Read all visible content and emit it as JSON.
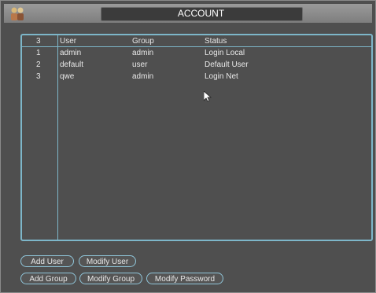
{
  "window": {
    "title": "ACCOUNT",
    "icon": "users-icon"
  },
  "table": {
    "headers": [
      "3",
      "User",
      "Group",
      "Status"
    ],
    "rows": [
      [
        "1",
        "admin",
        "admin",
        "Login Local"
      ],
      [
        "2",
        "default",
        "user",
        "Default User"
      ],
      [
        "3",
        "qwe",
        "admin",
        "Login Net"
      ]
    ]
  },
  "buttons": {
    "add_user": "Add User",
    "modify_user": "Modify User",
    "add_group": "Add Group",
    "modify_group": "Modify Group",
    "modify_password": "Modify Password"
  },
  "colors": {
    "background": "#4f4f4f",
    "accent": "#7db6c9",
    "text": "#e8e8e8"
  }
}
